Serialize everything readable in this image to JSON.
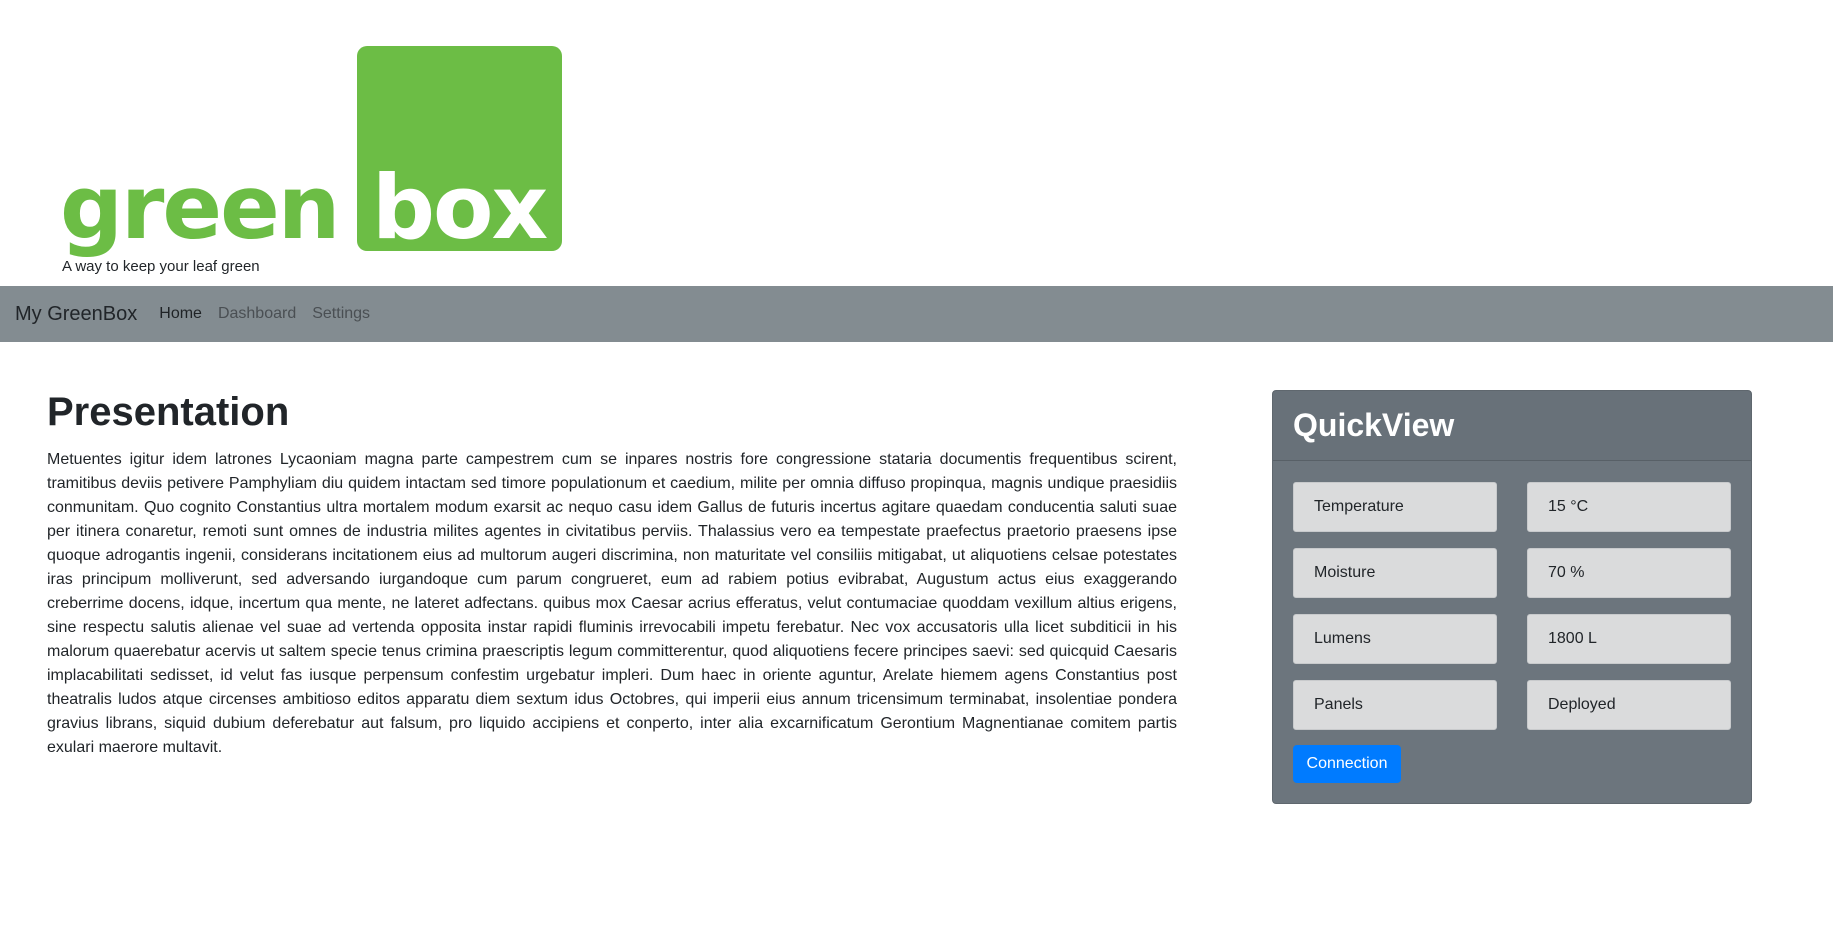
{
  "logo": {
    "word_left": "green",
    "word_right": "box",
    "tagline": "A way to keep your leaf green",
    "brand_color": "#6cbd45"
  },
  "nav": {
    "brand": "My GreenBox",
    "items": [
      {
        "label": "Home",
        "active": true
      },
      {
        "label": "Dashboard",
        "active": false
      },
      {
        "label": "Settings",
        "active": false
      }
    ],
    "background": "#838c91"
  },
  "main": {
    "title": "Presentation",
    "body": "Metuentes igitur idem latrones Lycaoniam magna parte campestrem cum se inpares nostris fore congressione stataria documentis frequentibus scirent, tramitibus deviis petivere Pamphyliam diu quidem intactam sed timore populationum et caedium, milite per omnia diffuso propinqua, magnis undique praesidiis conmunitam. Quo cognito Constantius ultra mortalem modum exarsit ac nequo casu idem Gallus de futuris incertus agitare quaedam conducentia saluti suae per itinera conaretur, remoti sunt omnes de industria milites agentes in civitatibus perviis. Thalassius vero ea tempestate praefectus praetorio praesens ipse quoque adrogantis ingenii, considerans incitationem eius ad multorum augeri discrimina, non maturitate vel consiliis mitigabat, ut aliquotiens celsae potestates iras principum molliverunt, sed adversando iurgandoque cum parum congrueret, eum ad rabiem potius evibrabat, Augustum actus eius exaggerando creberrime docens, idque, incertum qua mente, ne lateret adfectans. quibus mox Caesar acrius efferatus, velut contumaciae quoddam vexillum altius erigens, sine respectu salutis alienae vel suae ad vertenda opposita instar rapidi fluminis irrevocabili impetu ferebatur. Nec vox accusatoris ulla licet subditicii in his malorum quaerebatur acervis ut saltem specie tenus crimina praescriptis legum committerentur, quod aliquotiens fecere principes saevi: sed quicquid Caesaris implacabilitati sedisset, id velut fas iusque perpensum confestim urgebatur impleri. Dum haec in oriente aguntur, Arelate hiemem agens Constantius post theatralis ludos atque circenses ambitioso editos apparatu diem sextum idus Octobres, qui imperii eius annum tricensimum terminabat, insolentiae pondera gravius librans, siquid dubium deferebatur aut falsum, pro liquido accipiens et conperto, inter alia excarnificatum Gerontium Magnentianae comitem partis exulari maerore multavit."
  },
  "quickview": {
    "title": "QuickView",
    "rows": [
      {
        "label": "Temperature",
        "value": "15 °C"
      },
      {
        "label": "Moisture",
        "value": "70 %"
      },
      {
        "label": "Lumens",
        "value": "1800 L"
      },
      {
        "label": "Panels",
        "value": "Deployed"
      }
    ],
    "button_label": "Connection",
    "button_color": "#007bff",
    "card_color": "#6c757d"
  }
}
